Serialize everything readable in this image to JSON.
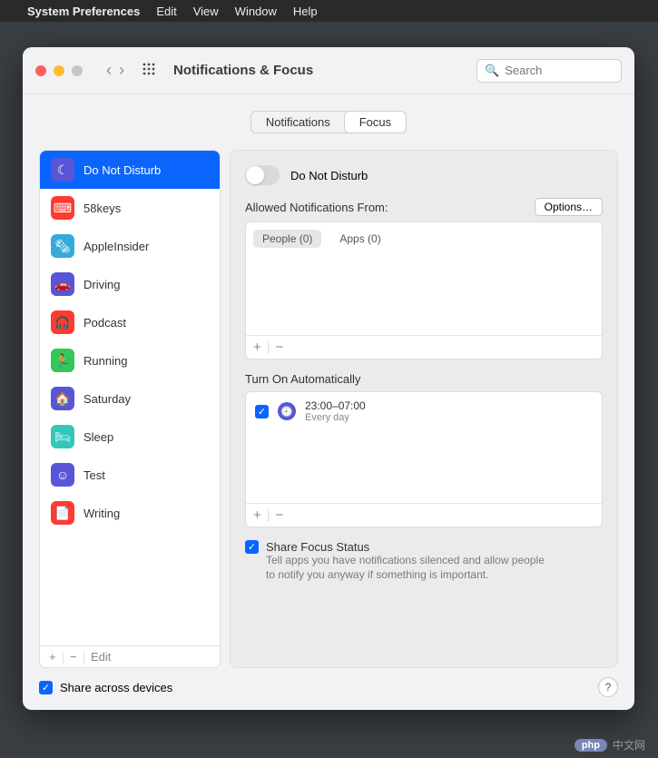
{
  "menubar": {
    "app_name": "System Preferences",
    "items": [
      "Edit",
      "View",
      "Window",
      "Help"
    ]
  },
  "window": {
    "title": "Notifications & Focus",
    "search_placeholder": "Search",
    "tabs": {
      "notifications": "Notifications",
      "focus": "Focus"
    }
  },
  "sidebar": {
    "items": [
      {
        "label": "Do Not Disturb",
        "color": "#5856d6",
        "glyph": "☾",
        "selected": true
      },
      {
        "label": "58keys",
        "color": "#ff3b30",
        "glyph": "⌨"
      },
      {
        "label": "AppleInsider",
        "color": "#34aadc",
        "glyph": "🗞"
      },
      {
        "label": "Driving",
        "color": "#5856d6",
        "glyph": "🚗"
      },
      {
        "label": "Podcast",
        "color": "#ff3b30",
        "glyph": "🎧"
      },
      {
        "label": "Running",
        "color": "#34c759",
        "glyph": "🏃"
      },
      {
        "label": "Saturday",
        "color": "#5856d6",
        "glyph": "🏠"
      },
      {
        "label": "Sleep",
        "color": "#33c6b9",
        "glyph": "🛏"
      },
      {
        "label": "Test",
        "color": "#5856d6",
        "glyph": "☺"
      },
      {
        "label": "Writing",
        "color": "#ff3b30",
        "glyph": "📄"
      }
    ],
    "footer": {
      "add": "+",
      "remove": "−",
      "edit": "Edit"
    }
  },
  "main": {
    "toggle_label": "Do Not Disturb",
    "allowed_label": "Allowed Notifications From:",
    "options_label": "Options…",
    "allowed_tabs": {
      "people": "People (0)",
      "apps": "Apps (0)"
    },
    "auto_label": "Turn On Automatically",
    "schedule": {
      "time": "23:00–07:00",
      "repeat": "Every day"
    },
    "share_focus_label": "Share Focus Status",
    "share_focus_desc": "Tell apps you have notifications silenced and allow people to notify you anyway if something is important."
  },
  "footer": {
    "share_devices": "Share across devices",
    "help": "?"
  },
  "watermark": {
    "badge": "php",
    "text": "中文网"
  }
}
